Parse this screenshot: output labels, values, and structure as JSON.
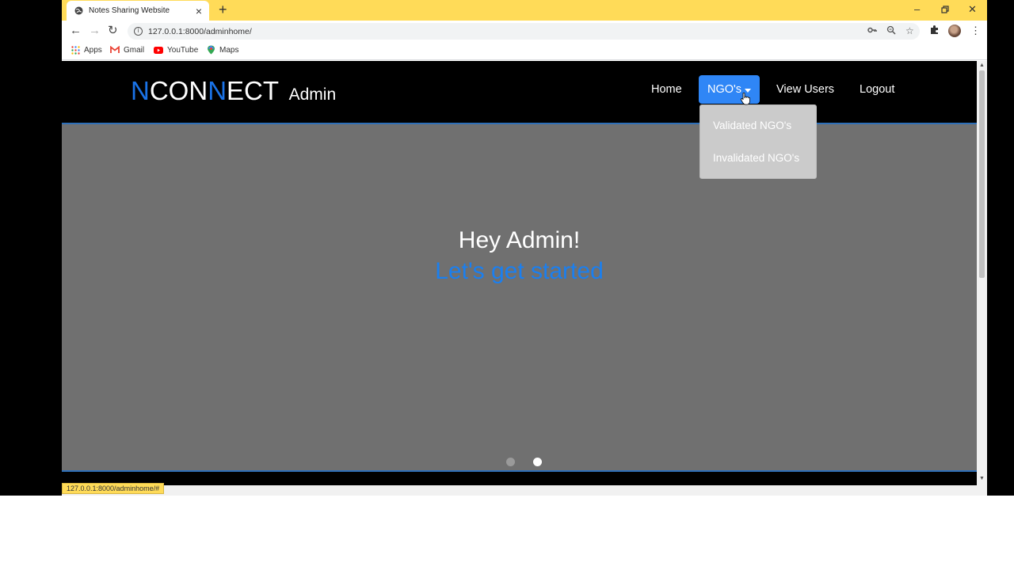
{
  "browser": {
    "tab_title": "Notes Sharing Website",
    "new_tab": "+",
    "url": "127.0.0.1:8000/adminhome/",
    "status_url": "127.0.0.1:8000/adminhome/#",
    "bookmarks": [
      "Apps",
      "Gmail",
      "YouTube",
      "Maps"
    ]
  },
  "brand": {
    "parts": [
      "N",
      "CON",
      "N",
      "ECT"
    ],
    "suffix": "Admin"
  },
  "nav": {
    "home": "Home",
    "ngos": "NGO's",
    "view_users": "View Users",
    "logout": "Logout"
  },
  "dropdown": {
    "items": [
      "Validated NGO's",
      "Invalidated NGO's"
    ]
  },
  "hero": {
    "title": "Hey Admin!",
    "subtitle": "Let's get started",
    "slides": 2,
    "active_slide": 2
  },
  "colors": {
    "accent": "#1a73e8",
    "tabstrip": "#ffdb58",
    "hero_bg": "#707070",
    "nav_active": "#2f86f6"
  }
}
